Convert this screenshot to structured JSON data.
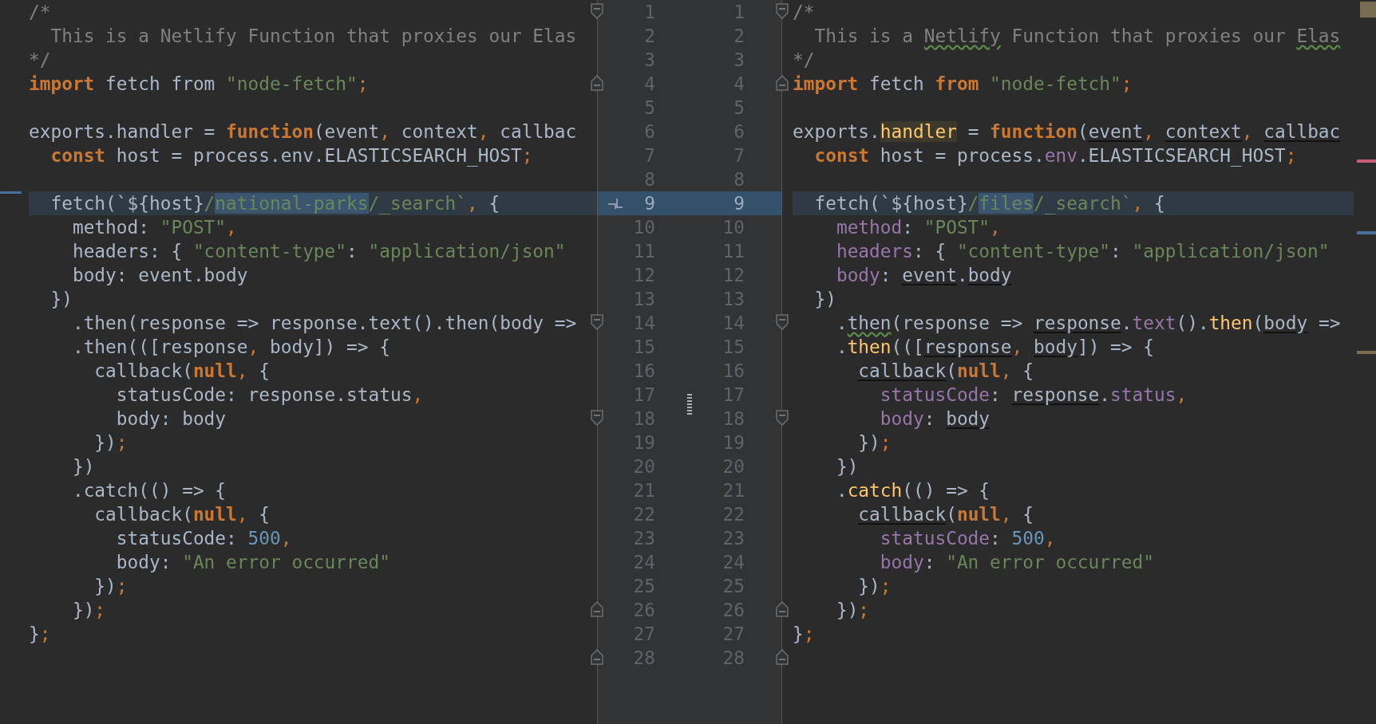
{
  "left_pane": {
    "lines": [
      {
        "changed": false,
        "tokens": [
          {
            "text": "/*",
            "kind": "comment"
          }
        ]
      },
      {
        "changed": false,
        "tokens": [
          {
            "text": "  This is a Netlify Function that proxies our Elas",
            "kind": "comment"
          }
        ]
      },
      {
        "changed": false,
        "tokens": [
          {
            "text": "*/",
            "kind": "comment"
          }
        ]
      },
      {
        "changed": false,
        "tokens": [
          {
            "text": "import",
            "kind": "keyword"
          },
          {
            "text": " fetch from ",
            "kind": "plain"
          },
          {
            "text": "\"node-fetch\"",
            "kind": "string"
          },
          {
            "text": ";",
            "kind": "punct"
          }
        ]
      },
      {
        "changed": false
      },
      {
        "changed": false,
        "tokens": [
          {
            "text": "exports.handler = ",
            "kind": "plain"
          },
          {
            "text": "function",
            "kind": "keyword"
          },
          {
            "text": "(event",
            "kind": "plain"
          },
          {
            "text": ", ",
            "kind": "punct"
          },
          {
            "text": "context",
            "kind": "plain"
          },
          {
            "text": ", ",
            "kind": "punct"
          },
          {
            "text": "callbac",
            "kind": "plain"
          }
        ]
      },
      {
        "changed": false,
        "tokens": [
          {
            "text": "  const",
            "kind": "keyword"
          },
          {
            "text": " host = process.env.ELASTICSEARCH_HOST",
            "kind": "plain"
          },
          {
            "text": ";",
            "kind": "punct"
          }
        ]
      },
      {
        "changed": false
      },
      {
        "changed": true,
        "tokens": [
          {
            "text": "  fetch(`${host}",
            "kind": "plain"
          },
          {
            "text": "/",
            "kind": "string"
          },
          {
            "text": "national-parks",
            "kind": "changed"
          },
          {
            "text": "/_search`",
            "kind": "string"
          },
          {
            "text": ", ",
            "kind": "punct"
          },
          {
            "text": "{",
            "kind": "plain"
          }
        ]
      },
      {
        "changed": false,
        "tokens": [
          {
            "text": "    method: ",
            "kind": "plain"
          },
          {
            "text": "\"POST\"",
            "kind": "string"
          },
          {
            "text": ",",
            "kind": "punct"
          }
        ]
      },
      {
        "changed": false,
        "tokens": [
          {
            "text": "    headers: { ",
            "kind": "plain"
          },
          {
            "text": "\"content-type\"",
            "kind": "string"
          },
          {
            "text": ": ",
            "kind": "plain"
          },
          {
            "text": "\"application/json\"",
            "kind": "string"
          }
        ]
      },
      {
        "changed": false,
        "tokens": [
          {
            "text": "    body: event.body",
            "kind": "plain"
          }
        ]
      },
      {
        "changed": false,
        "tokens": [
          {
            "text": "  })",
            "kind": "plain"
          }
        ]
      },
      {
        "changed": false,
        "tokens": [
          {
            "text": "    .then(response => response.text().then(body =>",
            "kind": "plain"
          }
        ]
      },
      {
        "changed": false,
        "tokens": [
          {
            "text": "    .then(([response",
            "kind": "plain"
          },
          {
            "text": ", ",
            "kind": "punct"
          },
          {
            "text": "body]) => {",
            "kind": "plain"
          }
        ]
      },
      {
        "changed": false,
        "tokens": [
          {
            "text": "      callback(",
            "kind": "plain"
          },
          {
            "text": "null",
            "kind": "keyword"
          },
          {
            "text": ", ",
            "kind": "punct"
          },
          {
            "text": "{",
            "kind": "plain"
          }
        ]
      },
      {
        "changed": false,
        "tokens": [
          {
            "text": "        statusCode: response.status",
            "kind": "plain"
          },
          {
            "text": ",",
            "kind": "punct"
          }
        ]
      },
      {
        "changed": false,
        "tokens": [
          {
            "text": "        body: body",
            "kind": "plain"
          }
        ]
      },
      {
        "changed": false,
        "tokens": [
          {
            "text": "      })",
            "kind": "plain"
          },
          {
            "text": ";",
            "kind": "punct"
          }
        ]
      },
      {
        "changed": false,
        "tokens": [
          {
            "text": "    })",
            "kind": "plain"
          }
        ]
      },
      {
        "changed": false,
        "tokens": [
          {
            "text": "    .catch(() => {",
            "kind": "plain"
          }
        ]
      },
      {
        "changed": false,
        "tokens": [
          {
            "text": "      callback(",
            "kind": "plain"
          },
          {
            "text": "null",
            "kind": "keyword"
          },
          {
            "text": ", ",
            "kind": "punct"
          },
          {
            "text": "{",
            "kind": "plain"
          }
        ]
      },
      {
        "changed": false,
        "tokens": [
          {
            "text": "        statusCode: ",
            "kind": "plain"
          },
          {
            "text": "500",
            "kind": "number"
          },
          {
            "text": ",",
            "kind": "punct"
          }
        ]
      },
      {
        "changed": false,
        "tokens": [
          {
            "text": "        body: ",
            "kind": "plain"
          },
          {
            "text": "\"An error occurred\"",
            "kind": "string"
          }
        ]
      },
      {
        "changed": false,
        "tokens": [
          {
            "text": "      })",
            "kind": "plain"
          },
          {
            "text": ";",
            "kind": "punct"
          }
        ]
      },
      {
        "changed": false,
        "tokens": [
          {
            "text": "    })",
            "kind": "plain"
          },
          {
            "text": ";",
            "kind": "punct"
          }
        ]
      },
      {
        "changed": false,
        "tokens": [
          {
            "text": "}",
            "kind": "plain"
          },
          {
            "text": ";",
            "kind": "punct"
          }
        ]
      },
      {
        "changed": false
      }
    ]
  },
  "gutter": {
    "rows": [
      {
        "left_number": "1",
        "right_number": "1",
        "changed": false,
        "fold_start": true,
        "fold_end": false,
        "apply_arrow": false
      },
      {
        "left_number": "2",
        "right_number": "2",
        "changed": false,
        "fold_start": false,
        "fold_end": false,
        "apply_arrow": false
      },
      {
        "left_number": "3",
        "right_number": "3",
        "changed": false,
        "fold_start": false,
        "fold_end": false,
        "apply_arrow": false
      },
      {
        "left_number": "4",
        "right_number": "4",
        "changed": false,
        "fold_start": false,
        "fold_end": true,
        "apply_arrow": false
      },
      {
        "left_number": "5",
        "right_number": "5",
        "changed": false,
        "fold_start": false,
        "fold_end": false,
        "apply_arrow": false
      },
      {
        "left_number": "6",
        "right_number": "6",
        "changed": false,
        "fold_start": false,
        "fold_end": false,
        "apply_arrow": false
      },
      {
        "left_number": "7",
        "right_number": "7",
        "changed": false,
        "fold_start": false,
        "fold_end": false,
        "apply_arrow": false
      },
      {
        "left_number": "8",
        "right_number": "8",
        "changed": false,
        "fold_start": false,
        "fold_end": false,
        "apply_arrow": false
      },
      {
        "left_number": "9",
        "right_number": "9",
        "changed": true,
        "fold_start": false,
        "fold_end": false,
        "apply_arrow": true
      },
      {
        "left_number": "10",
        "right_number": "10",
        "changed": false,
        "fold_start": false,
        "fold_end": false,
        "apply_arrow": false
      },
      {
        "left_number": "11",
        "right_number": "11",
        "changed": false,
        "fold_start": false,
        "fold_end": false,
        "apply_arrow": false
      },
      {
        "left_number": "12",
        "right_number": "12",
        "changed": false,
        "fold_start": false,
        "fold_end": false,
        "apply_arrow": false
      },
      {
        "left_number": "13",
        "right_number": "13",
        "changed": false,
        "fold_start": false,
        "fold_end": false,
        "apply_arrow": false
      },
      {
        "left_number": "14",
        "right_number": "14",
        "changed": false,
        "fold_start": true,
        "fold_end": false,
        "apply_arrow": false
      },
      {
        "left_number": "15",
        "right_number": "15",
        "changed": false,
        "fold_start": false,
        "fold_end": false,
        "apply_arrow": false
      },
      {
        "left_number": "16",
        "right_number": "16",
        "changed": false,
        "fold_start": false,
        "fold_end": false,
        "apply_arrow": false
      },
      {
        "left_number": "17",
        "right_number": "17",
        "changed": false,
        "fold_start": false,
        "fold_end": false,
        "apply_arrow": false
      },
      {
        "left_number": "18",
        "right_number": "18",
        "changed": false,
        "fold_start": true,
        "fold_end": false,
        "apply_arrow": false
      },
      {
        "left_number": "19",
        "right_number": "19",
        "changed": false,
        "fold_start": false,
        "fold_end": false,
        "apply_arrow": false
      },
      {
        "left_number": "20",
        "right_number": "20",
        "changed": false,
        "fold_start": false,
        "fold_end": false,
        "apply_arrow": false
      },
      {
        "left_number": "21",
        "right_number": "21",
        "changed": false,
        "fold_start": false,
        "fold_end": false,
        "apply_arrow": false
      },
      {
        "left_number": "22",
        "right_number": "22",
        "changed": false,
        "fold_start": false,
        "fold_end": false,
        "apply_arrow": false
      },
      {
        "left_number": "23",
        "right_number": "23",
        "changed": false,
        "fold_start": false,
        "fold_end": false,
        "apply_arrow": false
      },
      {
        "left_number": "24",
        "right_number": "24",
        "changed": false,
        "fold_start": false,
        "fold_end": false,
        "apply_arrow": false
      },
      {
        "left_number": "25",
        "right_number": "25",
        "changed": false,
        "fold_start": false,
        "fold_end": false,
        "apply_arrow": false
      },
      {
        "left_number": "26",
        "right_number": "26",
        "changed": false,
        "fold_start": false,
        "fold_end": true,
        "apply_arrow": false
      },
      {
        "left_number": "27",
        "right_number": "27",
        "changed": false,
        "fold_start": false,
        "fold_end": false,
        "apply_arrow": false
      },
      {
        "left_number": "28",
        "right_number": "28",
        "changed": false,
        "fold_start": false,
        "fold_end": true,
        "apply_arrow": false
      }
    ]
  },
  "right_pane": {
    "lines": [
      {
        "changed": false,
        "tokens": [
          {
            "text": "/*",
            "kind": "comment"
          }
        ]
      },
      {
        "changed": false,
        "tokens": [
          {
            "text": "  This is a ",
            "kind": "comment"
          },
          {
            "text": "Netlify",
            "kind": "typo"
          },
          {
            "text": " Function that proxies our ",
            "kind": "comment"
          },
          {
            "text": "Elas",
            "kind": "typo"
          }
        ]
      },
      {
        "changed": false,
        "tokens": [
          {
            "text": "*/",
            "kind": "comment"
          }
        ]
      },
      {
        "changed": false,
        "tokens": [
          {
            "text": "import",
            "kind": "keyword"
          },
          {
            "text": " fetch ",
            "kind": "plain"
          },
          {
            "text": "from",
            "kind": "keyword"
          },
          {
            "text": " \"node-fetch\"",
            "kind": "string"
          },
          {
            "text": ";",
            "kind": "punct"
          }
        ]
      },
      {
        "changed": false
      },
      {
        "changed": false,
        "tokens": [
          {
            "text": "exports.",
            "kind": "plain"
          },
          {
            "text": "handler",
            "kind": "highlight"
          },
          {
            "text": " = ",
            "kind": "plain"
          },
          {
            "text": "function",
            "kind": "keyword"
          },
          {
            "text": "(",
            "kind": "plain"
          },
          {
            "text": "event",
            "kind": "underlined"
          },
          {
            "text": ", ",
            "kind": "punct"
          },
          {
            "text": "context",
            "kind": "underlined"
          },
          {
            "text": ", ",
            "kind": "punct"
          },
          {
            "text": "callbac",
            "kind": "underlined"
          }
        ]
      },
      {
        "changed": false,
        "color": "#c75d79",
        "tokens": [
          {
            "text": "  const",
            "kind": "keyword"
          },
          {
            "text": " host = process.",
            "kind": "plain"
          },
          {
            "text": "env",
            "kind": "property"
          },
          {
            "text": ".ELASTICSEARCH_HOST",
            "kind": "plain"
          },
          {
            "text": ";",
            "kind": "punct"
          }
        ]
      },
      {
        "changed": false
      },
      {
        "changed": true,
        "tokens": [
          {
            "text": "  fetch(`${host}",
            "kind": "plain"
          },
          {
            "text": "/",
            "kind": "string"
          },
          {
            "text": "files",
            "kind": "changed"
          },
          {
            "text": "/_search`",
            "kind": "string"
          },
          {
            "text": ", ",
            "kind": "punct"
          },
          {
            "text": "{",
            "kind": "plain"
          }
        ]
      },
      {
        "changed": false,
        "color": "#4a6f98",
        "tokens": [
          {
            "text": "    method",
            "kind": "property"
          },
          {
            "text": ": ",
            "kind": "plain"
          },
          {
            "text": "\"POST\"",
            "kind": "string"
          },
          {
            "text": ",",
            "kind": "punct"
          }
        ]
      },
      {
        "changed": false,
        "tokens": [
          {
            "text": "    headers",
            "kind": "property"
          },
          {
            "text": ": { ",
            "kind": "plain"
          },
          {
            "text": "\"content-type\"",
            "kind": "string"
          },
          {
            "text": ": ",
            "kind": "plain"
          },
          {
            "text": "\"application/json\"",
            "kind": "string"
          }
        ]
      },
      {
        "changed": false,
        "tokens": [
          {
            "text": "    body",
            "kind": "property"
          },
          {
            "text": ": ",
            "kind": "plain"
          },
          {
            "text": "event",
            "kind": "underlined"
          },
          {
            "text": ".",
            "kind": "plain"
          },
          {
            "text": "body",
            "kind": "underlined"
          }
        ]
      },
      {
        "changed": false,
        "tokens": [
          {
            "text": "  })",
            "kind": "plain"
          }
        ]
      },
      {
        "changed": false,
        "tokens": [
          {
            "text": "    .",
            "kind": "plain"
          },
          {
            "text": "then",
            "kind": "typo_code"
          },
          {
            "text": "(response => ",
            "kind": "plain"
          },
          {
            "text": "response",
            "kind": "underlined"
          },
          {
            "text": ".",
            "kind": "plain"
          },
          {
            "text": "text",
            "kind": "property"
          },
          {
            "text": "().",
            "kind": "plain"
          },
          {
            "text": "then",
            "kind": "method"
          },
          {
            "text": "(",
            "kind": "plain"
          },
          {
            "text": "body",
            "kind": "underlined"
          },
          {
            "text": " =>",
            "kind": "plain"
          }
        ]
      },
      {
        "changed": false,
        "color": "#7d6e52",
        "tokens": [
          {
            "text": "    .",
            "kind": "plain"
          },
          {
            "text": "then",
            "kind": "method"
          },
          {
            "text": "(([",
            "kind": "plain"
          },
          {
            "text": "response",
            "kind": "underlined"
          },
          {
            "text": ", ",
            "kind": "punct"
          },
          {
            "text": "body",
            "kind": "underlined"
          },
          {
            "text": "]) => {",
            "kind": "plain"
          }
        ]
      },
      {
        "changed": false,
        "tokens": [
          {
            "text": "      callback",
            "kind": "underlined"
          },
          {
            "text": "(",
            "kind": "plain"
          },
          {
            "text": "null",
            "kind": "keyword"
          },
          {
            "text": ", ",
            "kind": "punct"
          },
          {
            "text": "{",
            "kind": "plain"
          }
        ]
      },
      {
        "changed": false,
        "tokens": [
          {
            "text": "        statusCode",
            "kind": "property"
          },
          {
            "text": ": ",
            "kind": "plain"
          },
          {
            "text": "response",
            "kind": "underlined"
          },
          {
            "text": ".",
            "kind": "plain"
          },
          {
            "text": "status",
            "kind": "property"
          },
          {
            "text": ",",
            "kind": "punct"
          }
        ]
      },
      {
        "changed": false,
        "tokens": [
          {
            "text": "        body",
            "kind": "property"
          },
          {
            "text": ": ",
            "kind": "plain"
          },
          {
            "text": "body",
            "kind": "underlined"
          }
        ]
      },
      {
        "changed": false,
        "tokens": [
          {
            "text": "      })",
            "kind": "plain"
          },
          {
            "text": ";",
            "kind": "punct"
          }
        ]
      },
      {
        "changed": false,
        "tokens": [
          {
            "text": "    })",
            "kind": "plain"
          }
        ]
      },
      {
        "changed": false,
        "tokens": [
          {
            "text": "    .",
            "kind": "plain"
          },
          {
            "text": "catch",
            "kind": "method"
          },
          {
            "text": "(() => {",
            "kind": "plain"
          }
        ]
      },
      {
        "changed": false,
        "tokens": [
          {
            "text": "      callback",
            "kind": "underlined"
          },
          {
            "text": "(",
            "kind": "plain"
          },
          {
            "text": "null",
            "kind": "keyword"
          },
          {
            "text": ", ",
            "kind": "punct"
          },
          {
            "text": "{",
            "kind": "plain"
          }
        ]
      },
      {
        "changed": false,
        "tokens": [
          {
            "text": "        statusCode",
            "kind": "property"
          },
          {
            "text": ": ",
            "kind": "plain"
          },
          {
            "text": "500",
            "kind": "number"
          },
          {
            "text": ",",
            "kind": "punct"
          }
        ]
      },
      {
        "changed": false,
        "tokens": [
          {
            "text": "        body",
            "kind": "property"
          },
          {
            "text": ": ",
            "kind": "plain"
          },
          {
            "text": "\"An error occurred\"",
            "kind": "string"
          }
        ]
      },
      {
        "changed": false,
        "tokens": [
          {
            "text": "      })",
            "kind": "plain"
          },
          {
            "text": ";",
            "kind": "punct"
          }
        ]
      },
      {
        "changed": false,
        "tokens": [
          {
            "text": "    })",
            "kind": "plain"
          },
          {
            "text": ";",
            "kind": "punct"
          }
        ]
      },
      {
        "changed": false,
        "tokens": [
          {
            "text": "}",
            "kind": "plain"
          },
          {
            "text": ";",
            "kind": "punct"
          }
        ]
      },
      {
        "changed": false
      }
    ]
  }
}
